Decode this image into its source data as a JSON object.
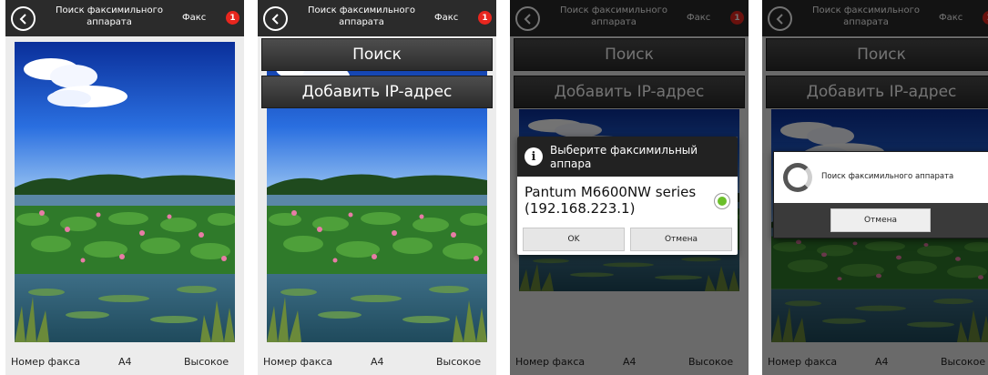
{
  "topbar": {
    "title": "Поиск факсимильного аппарата",
    "fax_label": "Факс",
    "badge_count": "1"
  },
  "menu": {
    "search_label": "Поиск",
    "add_ip_label": "Добавить IP-адрес"
  },
  "bottombar": {
    "fax_number_label": "Номер факса",
    "paper_size": "A4",
    "quality": "Высокое"
  },
  "select_dialog": {
    "title": "Выберите факсимильный аппара",
    "device_line1": "Pantum M6600NW series",
    "device_line2": "(192.168.223.1)",
    "ok_label": "OK",
    "cancel_label": "Отмена"
  },
  "progress_dialog": {
    "text": "Поиск факсимильного аппарата",
    "cancel_label": "Отмена"
  },
  "colors": {
    "topbar_bg": "#2b2b2b",
    "badge": "#e8261e",
    "radio_selected": "#6bbf2a"
  },
  "icons": [
    "back-arrow-icon",
    "info-icon",
    "radio-selected-icon",
    "spinner-icon"
  ]
}
